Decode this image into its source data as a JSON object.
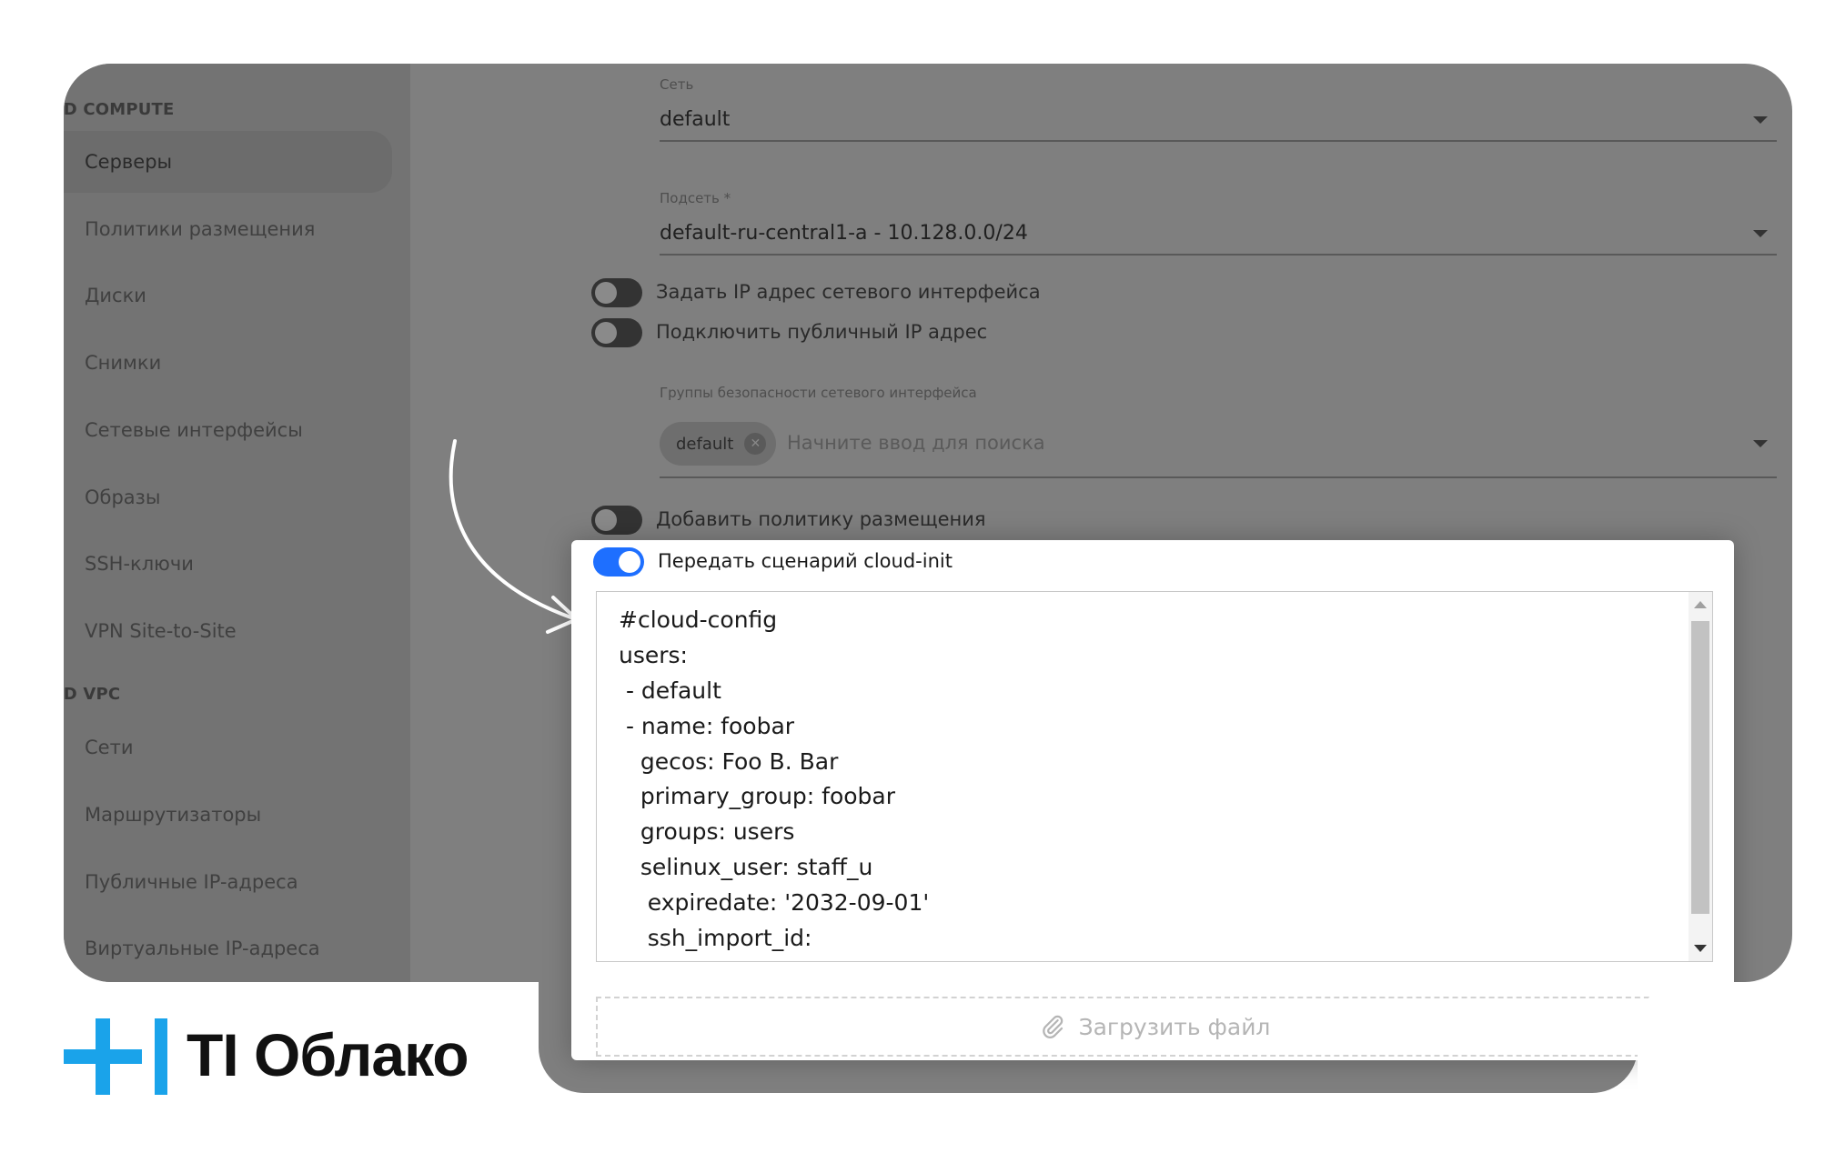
{
  "sidebar": {
    "sections": [
      {
        "label": "JUD COMPUTE"
      },
      {
        "label": "JUD VPC"
      }
    ],
    "items": [
      {
        "label": "Серверы"
      },
      {
        "label": "Политики размещения"
      },
      {
        "label": "Диски"
      },
      {
        "label": "Снимки"
      },
      {
        "label": "Сетевые интерфейсы"
      },
      {
        "label": "Образы"
      },
      {
        "label": "SSH-ключи"
      },
      {
        "label": "VPN Site-to-Site"
      },
      {
        "label": "Сети"
      },
      {
        "label": "Маршрутизаторы"
      },
      {
        "label": "Публичные IP-адреса"
      },
      {
        "label": "Виртуальные IP-адреса"
      }
    ]
  },
  "form": {
    "network": {
      "label": "Сеть",
      "value": "default"
    },
    "subnet": {
      "label": "Подсеть *",
      "value": "default-ru-central1-a - 10.128.0.0/24"
    },
    "toggles": {
      "set_ip": {
        "label": "Задать IP адрес сетевого интерфейса",
        "on": false
      },
      "public_ip": {
        "label": "Подключить публичный IP адрес",
        "on": false
      },
      "placement": {
        "label": "Добавить политику размещения",
        "on": false
      },
      "cloud_init": {
        "label": "Передать сценарий cloud-init",
        "on": true
      }
    },
    "security_groups": {
      "label": "Группы безопасности сетевого интерфейса",
      "chip": "default",
      "placeholder": "Начните ввод для поиска"
    },
    "cloud_init_lines": [
      "#cloud-config",
      "users:",
      " - default",
      " - name: foobar",
      "   gecos: Foo B. Bar",
      "   primary_group: foobar",
      "   groups: users",
      "   selinux_user: staff_u",
      "    expiredate: '2032-09-01'",
      "    ssh_import_id:"
    ],
    "upload_label": "Загрузить файл"
  },
  "logo": {
    "text": "TI Облако",
    "accent": "#1aa3ea"
  },
  "colors": {
    "toggle_on": "#1e6fff"
  }
}
